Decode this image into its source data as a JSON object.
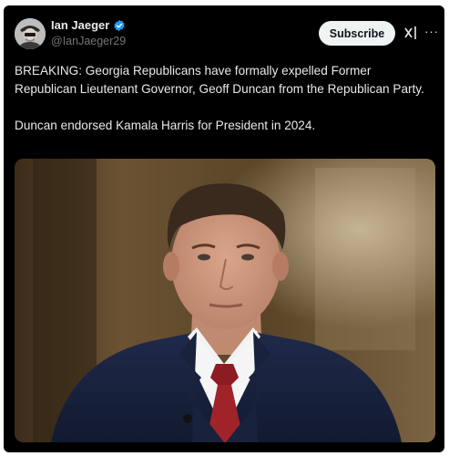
{
  "post": {
    "author": {
      "display_name": "Ian Jaeger",
      "handle": "@IanJaeger29",
      "verified": true,
      "avatar_icon": "avatar-portrait-icon",
      "verified_icon": "verified-badge-icon"
    },
    "actions": {
      "subscribe_label": "Subscribe",
      "grok_icon": "grok-icon",
      "more_label": "···"
    },
    "text": {
      "paragraph_1": "BREAKING: Georgia Republicans have formally expelled Former Republican Lieutenant Governor, Geoff Duncan from the Republican Party.",
      "paragraph_2": "Duncan endorsed Kamala Harris for President in 2024."
    },
    "media": {
      "type": "photo",
      "subject_icon": "photo-man-in-suit"
    }
  },
  "colors": {
    "background": "#000000",
    "text_primary": "#e7e9ea",
    "text_secondary": "#71767b",
    "verified_blue": "#1d9bf0",
    "subscribe_bg": "#eff3f4"
  }
}
